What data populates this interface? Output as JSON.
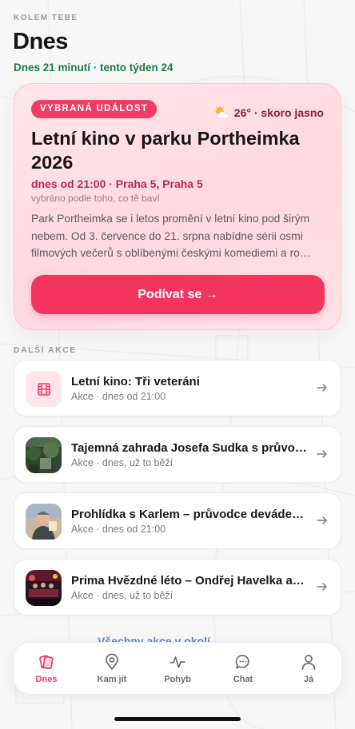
{
  "header": {
    "eyebrow": "KOLEM TEBE",
    "title": "Dnes",
    "stats": "Dnes 21 minutí · tento týden 24"
  },
  "featured": {
    "badge": "VYBRANÁ UDÁLOST",
    "weather": "26° · skoro jasno",
    "weather_icon": "sun-behind-cloud-icon",
    "title": "Letní kino v parku Portheimka 2026",
    "time_place": "dnes od 21:00 · Praha 5, Praha 5",
    "reason": "vybráno podle toho, co tě baví",
    "description": "Park Portheimka se i letos promění v letní kino pod širým nebem. Od 3. července do 21. srpna nabídne sérii osmi filmových večerů s oblíbenými českými komediemi a ro…",
    "cta_label": "Podívat se →"
  },
  "more": {
    "label": "DALŠÍ AKCE",
    "items": [
      {
        "title": "Letní kino: Tři veteráni",
        "subtitle": "Akce · dnes od 21:00",
        "thumb": "film-icon"
      },
      {
        "title": "Tajemná zahrada Josefa Sudka s průvodcem",
        "subtitle": "Akce · dnes, už to běží",
        "thumb": "garden-photo"
      },
      {
        "title": "Prohlídka s Karlem – průvodce deváde…",
        "subtitle": "Akce · dnes od 21:00",
        "thumb": "person-photo"
      },
      {
        "title": "Prima Hvězdné léto – Ondřej Havelka a jeho Melody Makers",
        "subtitle": "Akce · dnes, už to běží",
        "thumb": "concert-photo"
      }
    ],
    "see_all": "Všechny akce v okolí →"
  },
  "tabbar": {
    "tabs": [
      {
        "label": "Dnes",
        "icon": "cards-icon",
        "active": true
      },
      {
        "label": "Kam jít",
        "icon": "map-pin-icon",
        "active": false
      },
      {
        "label": "Pohyb",
        "icon": "activity-icon",
        "active": false
      },
      {
        "label": "Chat",
        "icon": "chat-bubble-icon",
        "active": false
      },
      {
        "label": "Já",
        "icon": "person-icon",
        "active": false
      }
    ]
  },
  "colors": {
    "accent": "#ef3d67",
    "stats_green": "#1f7a3a",
    "time_pink": "#b8285a"
  }
}
